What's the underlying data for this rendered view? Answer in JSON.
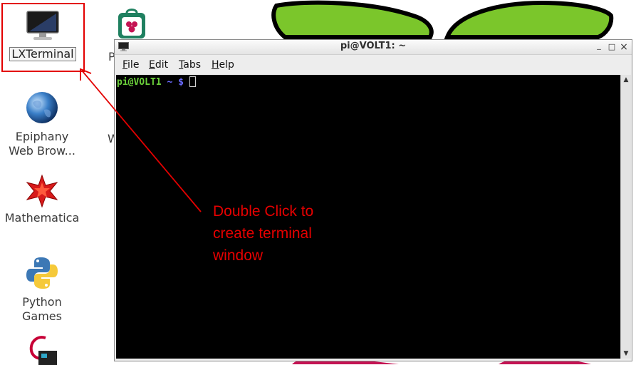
{
  "colors": {
    "berry_leaf": "#7bc62b",
    "berry_body": "#c41353",
    "annotation_red": "#e30000",
    "prompt_green": "#6bd13b",
    "prompt_blue": "#6b6bff"
  },
  "desktop": {
    "icons": [
      {
        "id": "lxterminal",
        "label": "LXTerminal",
        "icon": "monitor-icon"
      },
      {
        "id": "epiphany",
        "label_line1": "Epiphany",
        "label_line2": "Web Brow...",
        "icon": "globe-icon"
      },
      {
        "id": "mathematica",
        "label": "Mathematica",
        "icon": "mathematica-star-icon"
      },
      {
        "id": "python",
        "label_line1": "Python",
        "label_line2": "Games",
        "icon": "python-icon"
      },
      {
        "id": "debian",
        "icon": "debian-icon"
      },
      {
        "id": "pi-store",
        "icon": "pi-store-icon",
        "partial_label": "P"
      }
    ],
    "partial_label_2": "W"
  },
  "terminal": {
    "title": "pi@VOLT1: ~",
    "menu": [
      {
        "label": "File",
        "mnemonic": "F",
        "rest": "ile"
      },
      {
        "label": "Edit",
        "mnemonic": "E",
        "rest": "dit"
      },
      {
        "label": "Tabs",
        "mnemonic": "T",
        "rest": "abs"
      },
      {
        "label": "Help",
        "mnemonic": "H",
        "rest": "elp"
      }
    ],
    "prompt_user": "pi@VOLT1",
    "prompt_path": " ~ $ ",
    "controls": {
      "minimize": "_",
      "maximize": "□",
      "close": "×"
    }
  },
  "annotation": {
    "line1": "Double Click to",
    "line2": "create terminal",
    "line3": "window"
  }
}
